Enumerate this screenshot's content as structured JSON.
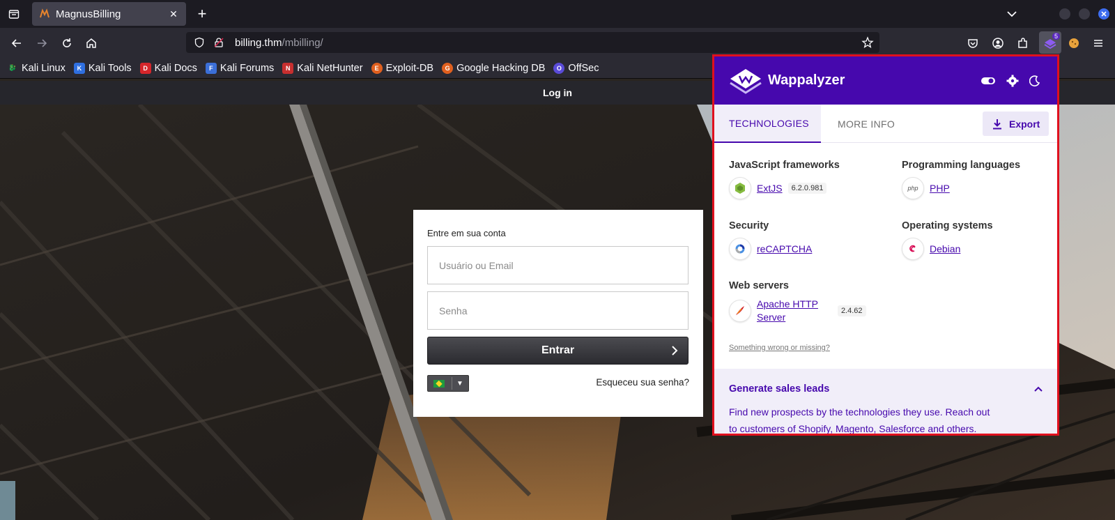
{
  "browser": {
    "tab": {
      "title": "MagnusBilling"
    },
    "url": {
      "host": "billing.thm",
      "path": "/mbilling/"
    },
    "extension_badge": "5"
  },
  "bookmarks": [
    {
      "label": "Kali Linux",
      "icon": "kali-dragon-icon"
    },
    {
      "label": "Kali Tools",
      "icon": "kali-tools-icon"
    },
    {
      "label": "Kali Docs",
      "icon": "kali-docs-icon"
    },
    {
      "label": "Kali Forums",
      "icon": "kali-forums-icon"
    },
    {
      "label": "Kali NetHunter",
      "icon": "nethunter-icon"
    },
    {
      "label": "Exploit-DB",
      "icon": "exploit-db-icon"
    },
    {
      "label": "Google Hacking DB",
      "icon": "ghdb-icon"
    },
    {
      "label": "OffSec",
      "icon": "offsec-icon"
    }
  ],
  "page": {
    "header_title": "Log in",
    "login": {
      "title": "Entre em sua conta",
      "username_placeholder": "Usuário ou Email",
      "password_placeholder": "Senha",
      "submit_label": "Entrar",
      "forgot_label": "Esqueceu sua senha?",
      "language_flag": "brazil-flag-icon"
    }
  },
  "wappalyzer": {
    "name": "Wappalyzer",
    "tabs": [
      "TECHNOLOGIES",
      "MORE INFO"
    ],
    "export_label": "Export",
    "categories": [
      {
        "title": "JavaScript frameworks",
        "techs": [
          {
            "name": "ExtJS",
            "version": "6.2.0.981"
          }
        ]
      },
      {
        "title": "Programming languages",
        "techs": [
          {
            "name": "PHP",
            "icon_text": "php"
          }
        ]
      },
      {
        "title": "Security",
        "techs": [
          {
            "name": "reCAPTCHA"
          }
        ]
      },
      {
        "title": "Operating systems",
        "techs": [
          {
            "name": "Debian"
          }
        ]
      },
      {
        "title": "Web servers",
        "techs": [
          {
            "name": "Apache HTTP Server",
            "name_line1": "Apache HTTP",
            "name_line2": "Server",
            "version": "2.4.62"
          }
        ]
      }
    ],
    "wrong_link": "Something wrong or missing?",
    "leads": {
      "title": "Generate sales leads",
      "text": "Find new prospects by the technologies they use. Reach out to customers of Shopify, Magento, Salesforce and others."
    },
    "colors": {
      "brand": "#4608ad",
      "highlight_border": "#e0101e"
    }
  }
}
